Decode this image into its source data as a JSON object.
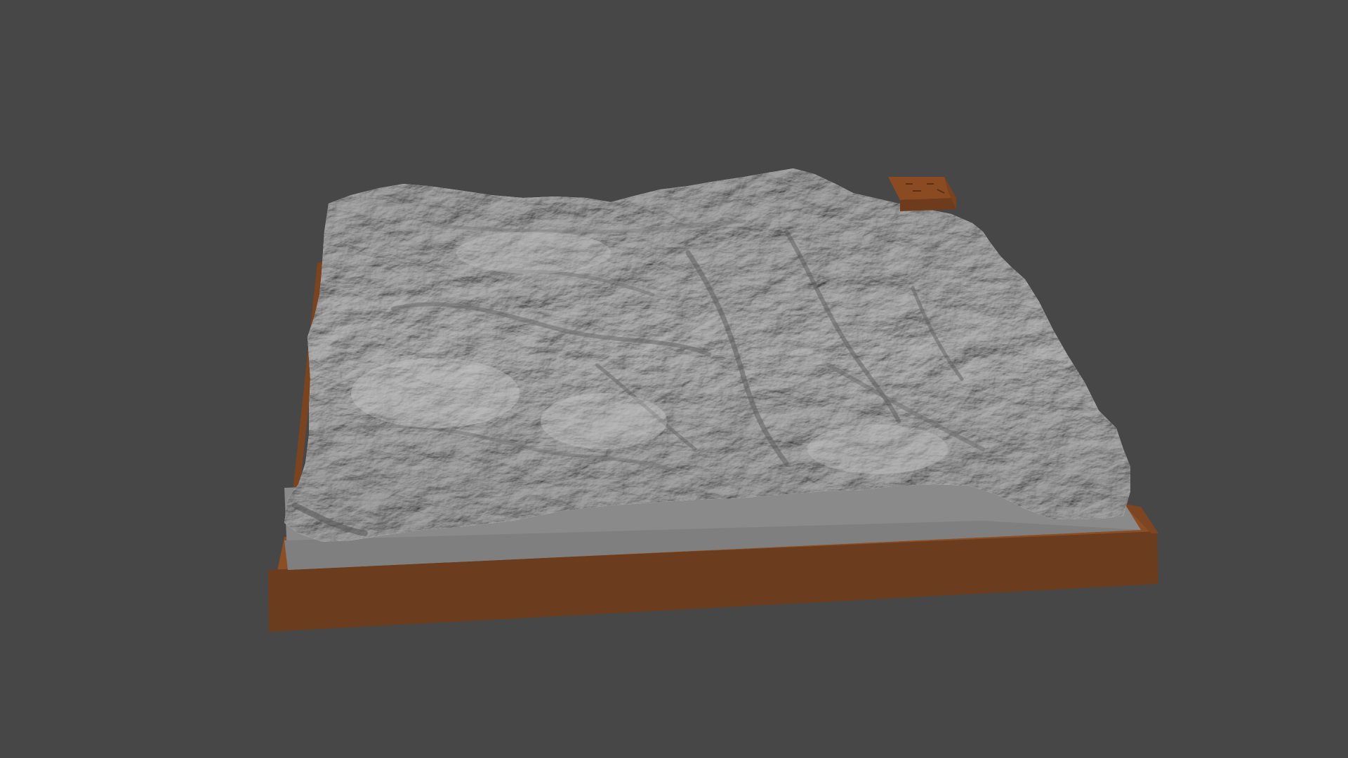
{
  "scene": {
    "description_shown": "",
    "colors": {
      "background": "#474747",
      "terrain_light": "#b3b3b3",
      "terrain_mid": "#9a9a9a",
      "terrain_dark": "#5c5c5c",
      "terrain_flat": "#8a8a8a",
      "base_front": "#6b3d1e",
      "base_top": "#8c4e24",
      "base_side": "#7a4420",
      "marker_box": "#8a4a22"
    },
    "objects": [
      {
        "name": "terrain-relief-model"
      },
      {
        "name": "wooden-base-frame"
      },
      {
        "name": "corner-marker-block"
      }
    ]
  }
}
